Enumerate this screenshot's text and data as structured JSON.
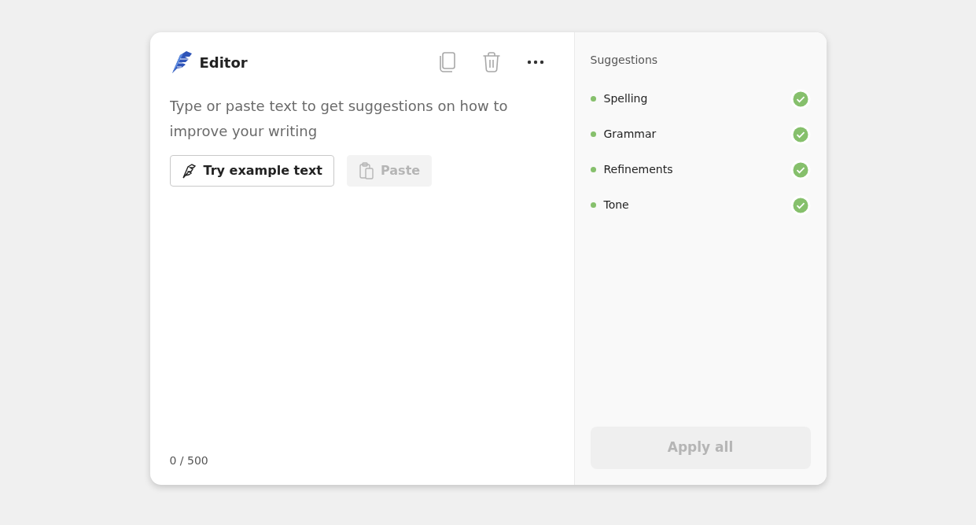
{
  "editor": {
    "title": "Editor",
    "toolbar": [
      {
        "kind": "copy",
        "disabled": true
      },
      {
        "kind": "delete",
        "disabled": true
      },
      {
        "kind": "more",
        "disabled": false
      }
    ],
    "input": {
      "placeholder": "Type or paste text to get suggestions on how to improve your writing"
    },
    "actions": [
      {
        "kind": "example",
        "label": "Try example text",
        "disabled": false
      },
      {
        "kind": "paste",
        "label": "Paste",
        "disabled": true
      }
    ],
    "counter": "0 / 500"
  },
  "suggestions": {
    "title": "Suggestions",
    "items": [
      {
        "label": "Spelling",
        "color": "#86c06c",
        "checked": true
      },
      {
        "label": "Grammar",
        "color": "#86c06c",
        "checked": true
      },
      {
        "label": "Refinements",
        "color": "#86c06c",
        "checked": true
      },
      {
        "label": "Tone",
        "color": "#86c06c",
        "checked": true
      }
    ],
    "apply": {
      "label": "Apply all",
      "disabled": true
    }
  }
}
